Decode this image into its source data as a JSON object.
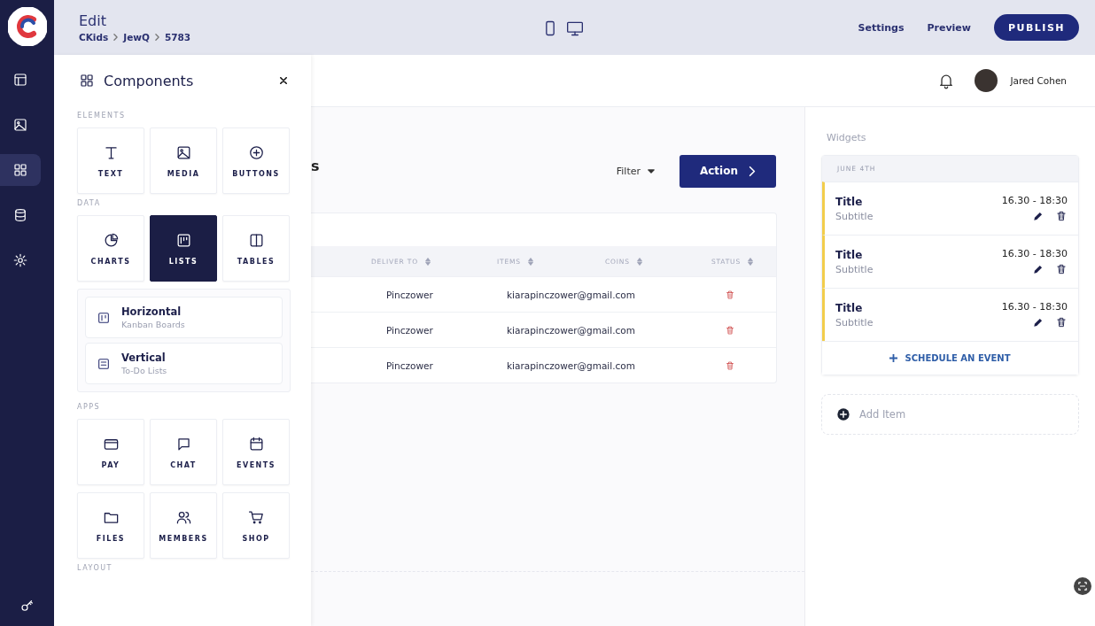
{
  "nav": {
    "items": [
      {
        "selected": false
      },
      {
        "selected": false
      },
      {
        "selected": true
      },
      {
        "selected": false
      },
      {
        "selected": false
      }
    ]
  },
  "topbar": {
    "title": "Edit",
    "breadcrumb": [
      "CKids",
      "JewQ",
      "5783"
    ],
    "links": [
      "Settings",
      "Preview"
    ],
    "publish": "PUBLISH"
  },
  "components": {
    "title": "Components",
    "sections": [
      {
        "heading": "ELEMENTS",
        "tiles": [
          {
            "label": "TEXT",
            "selected": false
          },
          {
            "label": "MEDIA",
            "selected": false
          },
          {
            "label": "BUTTONS",
            "selected": false
          }
        ]
      },
      {
        "heading": "DATA",
        "tiles": [
          {
            "label": "CHARTS",
            "selected": false
          },
          {
            "label": "LISTS",
            "selected": true
          },
          {
            "label": "TABLES",
            "selected": false
          }
        ],
        "submenu": [
          {
            "title": "Horizontal",
            "subtitle": "Kanban Boards"
          },
          {
            "title": "Vertical",
            "subtitle": "To-Do Lists"
          }
        ]
      },
      {
        "heading": "APPS",
        "tiles": [
          {
            "label": "PAY",
            "selected": false
          },
          {
            "label": "CHAT",
            "selected": false
          },
          {
            "label": "EVENTS",
            "selected": false
          },
          {
            "label": "FILES",
            "selected": false
          },
          {
            "label": "MEMBERS",
            "selected": false
          },
          {
            "label": "SHOP",
            "selected": false
          }
        ]
      },
      {
        "heading": "LAYOUT"
      }
    ]
  },
  "header": {
    "user": "Jared Cohen"
  },
  "content": {
    "title_fragment": "s",
    "filter": "Filter",
    "action": "Action",
    "table": {
      "columns": [
        "DELIVER TO",
        "ITEMS",
        "COINS",
        "STATUS"
      ],
      "rows": [
        {
          "deliver_to": "Pinczower",
          "email": "kiarapinczower@gmail.com"
        },
        {
          "deliver_to": "Pinczower",
          "email": "kiarapinczower@gmail.com"
        },
        {
          "deliver_to": "Pinczower",
          "email": "kiarapinczower@gmail.com"
        }
      ]
    }
  },
  "widgets": {
    "heading": "Widgets",
    "date": "JUNE 4TH",
    "events": [
      {
        "title": "Title",
        "subtitle": "Subtitle",
        "time": "16.30 - 18:30"
      },
      {
        "title": "Title",
        "subtitle": "Subtitle",
        "time": "16.30 - 18:30"
      },
      {
        "title": "Title",
        "subtitle": "Subtitle",
        "time": "16.30 - 18:30"
      }
    ],
    "schedule": "SCHEDULE AN EVENT",
    "add_item": "Add Item"
  }
}
